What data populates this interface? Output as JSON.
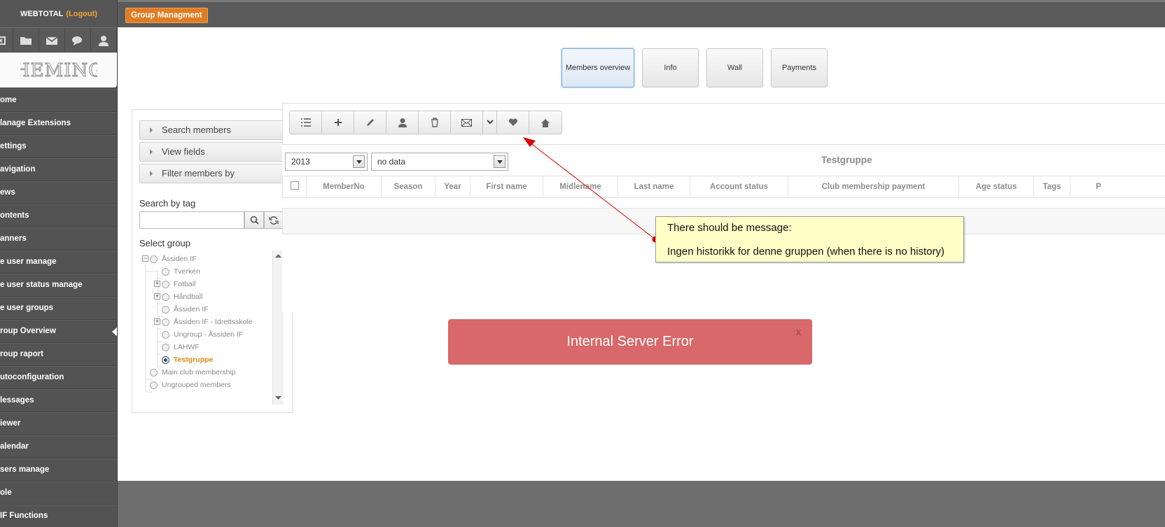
{
  "sidebar": {
    "user": "WEBTOTAL",
    "logout": "(Logout)",
    "logo": "HEMING",
    "icons": [
      "close-icon",
      "folder-icon",
      "mail-icon",
      "chat-icon",
      "user-icon"
    ],
    "items": [
      {
        "label": "ome"
      },
      {
        "label": "lanage Extensions"
      },
      {
        "label": "ettings"
      },
      {
        "label": "avigation"
      },
      {
        "label": "ews"
      },
      {
        "label": "ontents"
      },
      {
        "label": "anners"
      },
      {
        "label": "e user manage"
      },
      {
        "label": "e user status manage"
      },
      {
        "label": "e user groups"
      },
      {
        "label": "roup Overview",
        "active": true
      },
      {
        "label": "roup raport"
      },
      {
        "label": "utoconfiguration"
      },
      {
        "label": "lessages"
      },
      {
        "label": "iewer"
      },
      {
        "label": "alendar"
      },
      {
        "label": "sers manage"
      },
      {
        "label": "ole"
      },
      {
        "label": "IF Functions"
      }
    ]
  },
  "header": {
    "badge": "Group Managment"
  },
  "tabs": [
    "Members overview",
    "Info",
    "Wall",
    "Payments"
  ],
  "left_panel": {
    "accordions": [
      "Search members",
      "View fields",
      "Filter members by"
    ],
    "search_tag_label": "Search by tag",
    "search_tag_value": "",
    "select_group_label": "Select group",
    "tree": [
      {
        "label": "Åssiden IF",
        "level": 0,
        "expand": "minus"
      },
      {
        "label": "Tverken",
        "level": 1
      },
      {
        "label": "Fotball",
        "level": 1,
        "expand": "plus"
      },
      {
        "label": "Håndball",
        "level": 1,
        "expand": "plus"
      },
      {
        "label": "Åssiden IF",
        "level": 1
      },
      {
        "label": "Åssiden IF - Idrettsskole",
        "level": 1,
        "expand": "plus"
      },
      {
        "label": "Ungroup - Åssiden IF",
        "level": 1
      },
      {
        "label": "LAHWF",
        "level": 1
      },
      {
        "label": "Testgruppe",
        "level": 1,
        "selected": true
      },
      {
        "label": "Main club membership",
        "level": 0
      },
      {
        "label": "Ungrouped members",
        "level": 0
      }
    ]
  },
  "toolbar": [
    "list-icon",
    "add-icon",
    "edit-icon",
    "user-icon",
    "trash-icon",
    "mail-icon",
    "chevron-down-icon",
    "heart-icon",
    "home-icon"
  ],
  "filters": {
    "year": "2013",
    "data": "no data"
  },
  "grid": {
    "title": "Testgruppe",
    "columns": [
      "MemberNo",
      "Season",
      "Year",
      "First name",
      "Midlename",
      "Last name",
      "Account status",
      "Club membership payment",
      "Age status",
      "Tags",
      "P"
    ]
  },
  "annotation": {
    "line1": "There should be message:",
    "line2": "Ingen historikk for denne gruppen (when there is no history)"
  },
  "error": {
    "message": "Internal Server Error",
    "close": "x"
  },
  "colors": {
    "accent": "#e07c22",
    "error": "#d8686a",
    "note": "#ffffc8",
    "arrow": "#dd0000"
  }
}
